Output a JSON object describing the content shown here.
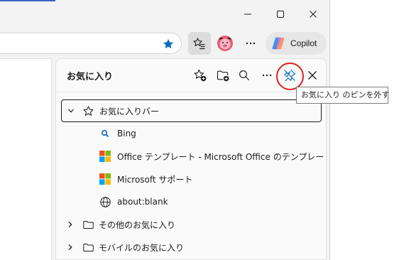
{
  "panel": {
    "title": "お気に入り",
    "tooltip": "お気に入り のピンを外す"
  },
  "toolbar": {
    "copilot_label": "Copilot"
  },
  "favorites": {
    "root": {
      "label": "お気に入りバー"
    },
    "items": [
      {
        "label": "Bing",
        "icon": "bing-search-icon"
      },
      {
        "label": "Office テンプレート - Microsoft Office のテンプレー",
        "icon": "microsoft-logo-icon"
      },
      {
        "label": "Microsoft サポート",
        "icon": "microsoft-logo-icon"
      },
      {
        "label": "about:blank",
        "icon": "globe-icon"
      }
    ],
    "folders": [
      {
        "label": "その他のお気に入り"
      },
      {
        "label": "モバイルのお気に入り"
      }
    ]
  },
  "colors": {
    "accent": "#0f6cbd",
    "annotation": "#e02020",
    "ms_red": "#f25022",
    "ms_green": "#7fba00",
    "ms_blue": "#00a4ef",
    "ms_yellow": "#ffb900"
  }
}
